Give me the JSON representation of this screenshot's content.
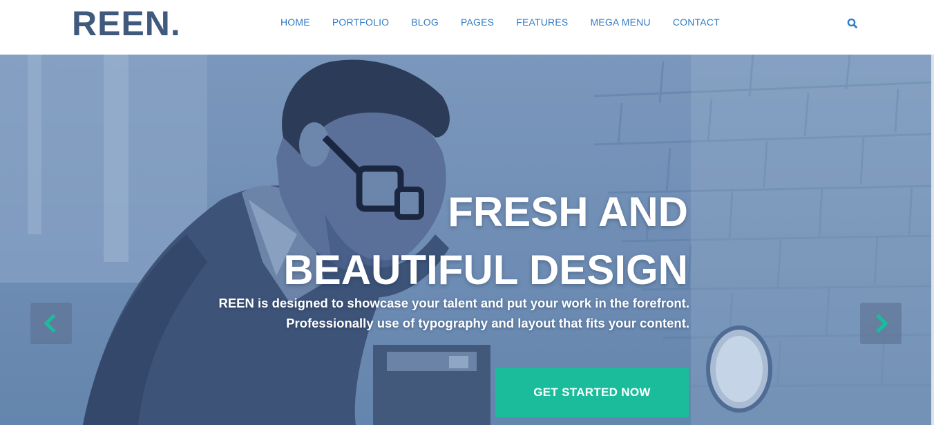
{
  "header": {
    "logo": "REEN.",
    "nav": [
      "HOME",
      "PORTFOLIO",
      "BLOG",
      "PAGES",
      "FEATURES",
      "MEGA MENU",
      "CONTACT"
    ],
    "search_icon": "search-icon"
  },
  "hero": {
    "headline_line1": "FRESH AND",
    "headline_line2": "BEAUTIFUL DESIGN",
    "subline_line1": "REEN is designed to showcase your talent and put your work in the forefront.",
    "subline_line2": "Professionally use of typography and layout that fits your content.",
    "cta_label": "GET STARTED NOW",
    "prev_icon": "chevron-left-icon",
    "next_icon": "chevron-right-icon"
  },
  "colors": {
    "brand": "#3f5a7c",
    "nav_link": "#2f7bc8",
    "accent": "#1abc9c",
    "hero_overlay": "#7090b8"
  }
}
